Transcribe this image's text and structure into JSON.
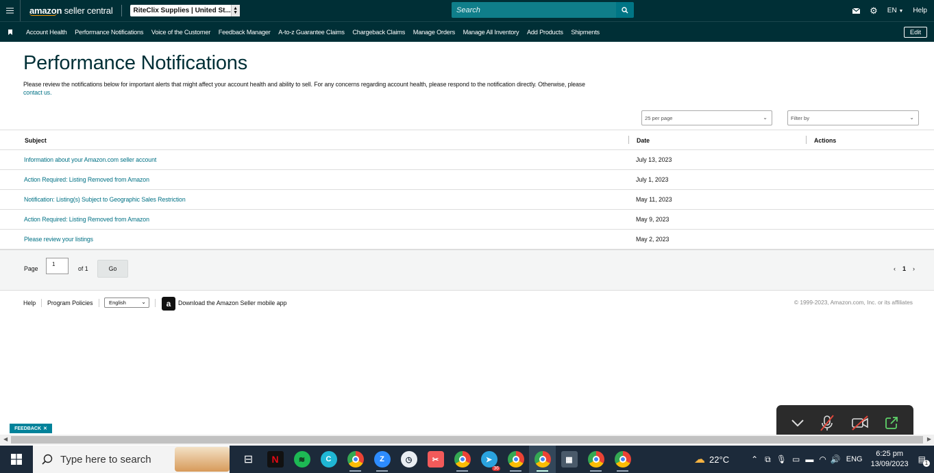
{
  "header": {
    "logo_main": "amazon",
    "logo_sub": "seller central",
    "account": "RiteClix Supplies | United St...",
    "search_placeholder": "Search",
    "language": "EN",
    "help": "Help"
  },
  "nav": {
    "items": [
      "Account Health",
      "Performance Notifications",
      "Voice of the Customer",
      "Feedback Manager",
      "A-to-z Guarantee Claims",
      "Chargeback Claims",
      "Manage Orders",
      "Manage All Inventory",
      "Add Products",
      "Shipments"
    ],
    "edit": "Edit"
  },
  "page": {
    "title": "Performance Notifications",
    "intro": "Please review the notifications below for important alerts that might affect your account health and ability to sell. For any concerns regarding account health, please respond to the notification directly. Otherwise, please",
    "intro_link": "contact us.",
    "per_page": "25 per page",
    "filter": "Filter by"
  },
  "table": {
    "headers": {
      "subject": "Subject",
      "date": "Date",
      "actions": "Actions"
    },
    "rows": [
      {
        "subject": "Information about your Amazon.com seller account",
        "date": "July 13, 2023"
      },
      {
        "subject": "Action Required: Listing Removed from Amazon",
        "date": "July 1, 2023"
      },
      {
        "subject": "Notification: Listing(s) Subject to Geographic Sales Restriction",
        "date": "May 11, 2023"
      },
      {
        "subject": "Action Required: Listing Removed from Amazon",
        "date": "May 9, 2023"
      },
      {
        "subject": "Please review your listings",
        "date": "May 2, 2023"
      }
    ]
  },
  "pager": {
    "page_label": "Page",
    "page_value": "1",
    "of_label": "of 1",
    "go": "Go",
    "current": "1"
  },
  "footer": {
    "help": "Help",
    "policies": "Program Policies",
    "language": "English",
    "app": "Download the Amazon Seller mobile app",
    "copyright": "© 1999-2023, Amazon.com, Inc. or its affiliates"
  },
  "feedback": "FEEDBACK",
  "taskbar": {
    "search_placeholder": "Type here to search",
    "telegram_badge": "36",
    "weather": "22°C",
    "lang": "ENG",
    "time": "6:25 pm",
    "date": "13/09/2023",
    "notif_count": "1"
  },
  "colors": {
    "header_bg": "#002f36",
    "link": "#007185",
    "search_bg": "#0f7e8a"
  }
}
